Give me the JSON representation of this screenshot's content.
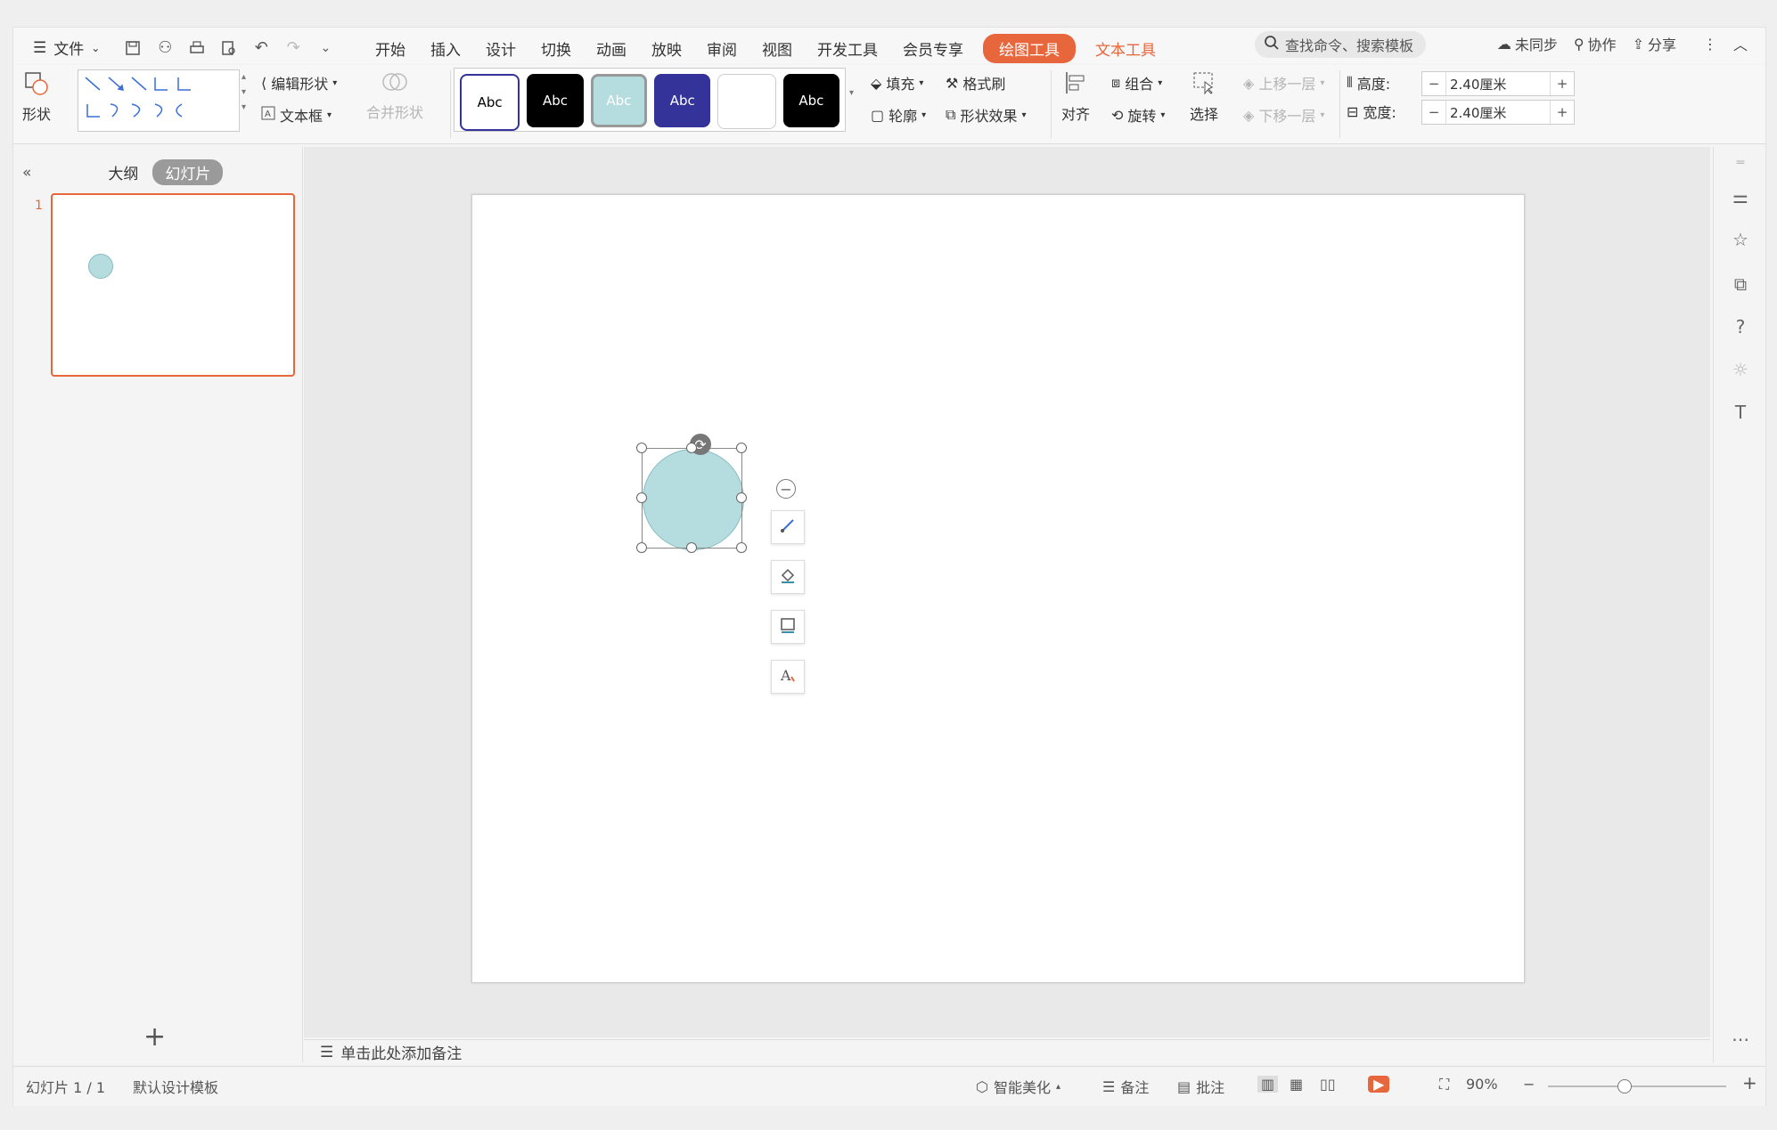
{
  "menu": {
    "file_label": "文件",
    "tabs": [
      "开始",
      "插入",
      "设计",
      "切换",
      "动画",
      "放映",
      "审阅",
      "视图",
      "开发工具",
      "会员专享"
    ],
    "drawing_tools": "绘图工具",
    "text_tools": "文本工具",
    "search_placeholder": "查找命令、搜索模板",
    "unsynced": "未同步",
    "collaborate": "协作",
    "share": "分享"
  },
  "ribbon": {
    "shape": "形状",
    "edit_shape": "编辑形状",
    "text_box": "文本框",
    "merge_shape": "合并形状",
    "styles": [
      "Abc",
      "Abc",
      "Abc",
      "Abc",
      "",
      "Abc"
    ],
    "style_colors": [
      "#ffffff",
      "#000000",
      "#b5dde0",
      "#333399",
      "#ffffff",
      "#000000"
    ],
    "fill": "填充",
    "format_painter": "格式刷",
    "outline": "轮廓",
    "shape_effect": "形状效果",
    "align": "对齐",
    "group": "组合",
    "rotate": "旋转",
    "select": "选择",
    "bring_forward": "上移一层",
    "send_backward": "下移一层",
    "height_label": "高度:",
    "height_value": "2.40厘米",
    "width_label": "宽度:",
    "width_value": "2.40厘米"
  },
  "panel": {
    "outline_tab": "大纲",
    "slides_tab": "幻灯片",
    "slide_number": "1",
    "add_slide": "+"
  },
  "canvas": {
    "shape_fill": "#b5dde0"
  },
  "notes": {
    "placeholder": "单击此处添加备注"
  },
  "status": {
    "slide_info": "幻灯片 1 / 1",
    "template": "默认设计模板",
    "smart_beautify": "智能美化",
    "notes": "备注",
    "comments": "批注",
    "zoom": "90%"
  }
}
